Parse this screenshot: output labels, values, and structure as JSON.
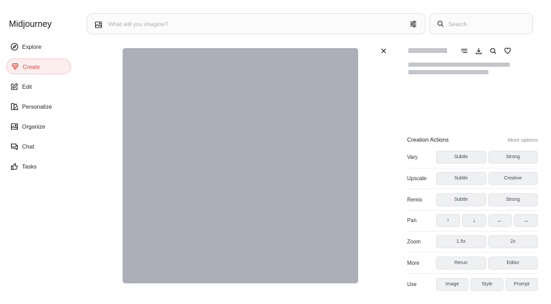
{
  "app": {
    "title": "Midjourney"
  },
  "sidebar": {
    "items": [
      {
        "label": "Explore",
        "icon": "compass-icon",
        "active": false
      },
      {
        "label": "Create",
        "icon": "brush-icon",
        "active": true
      },
      {
        "label": "Edit",
        "icon": "edit-icon",
        "active": false
      },
      {
        "label": "Personalize",
        "icon": "palette-icon",
        "active": false
      },
      {
        "label": "Organize",
        "icon": "image-gallery-icon",
        "active": false
      },
      {
        "label": "Chat",
        "icon": "chat-icon",
        "active": false
      },
      {
        "label": "Tasks",
        "icon": "thumbs-up-icon",
        "active": false
      }
    ]
  },
  "prompt": {
    "placeholder": "What will you imagine?",
    "value": ""
  },
  "search": {
    "placeholder": "Search",
    "value": ""
  },
  "actions": {
    "title": "Creation Actions",
    "more_options": "More options",
    "rows": [
      {
        "label": "Vary",
        "buttons": [
          "Subtle",
          "Strong"
        ]
      },
      {
        "label": "Upscale",
        "buttons": [
          "Subtle",
          "Creative"
        ]
      },
      {
        "label": "Remix",
        "buttons": [
          "Subtle",
          "Strong"
        ]
      },
      {
        "label": "Pan",
        "buttons": [
          "↑",
          "↓",
          "←",
          "→"
        ]
      },
      {
        "label": "Zoom",
        "buttons": [
          "1.5x",
          "2x"
        ]
      },
      {
        "label": "More",
        "buttons": [
          "Rerun",
          "Editor"
        ]
      },
      {
        "label": "Use",
        "buttons": [
          "Image",
          "Style",
          "Prompt"
        ]
      }
    ]
  },
  "colors": {
    "accent": "#e0443f",
    "image_placeholder": "#acafb7",
    "text_placeholder": "#c3c5ca"
  }
}
